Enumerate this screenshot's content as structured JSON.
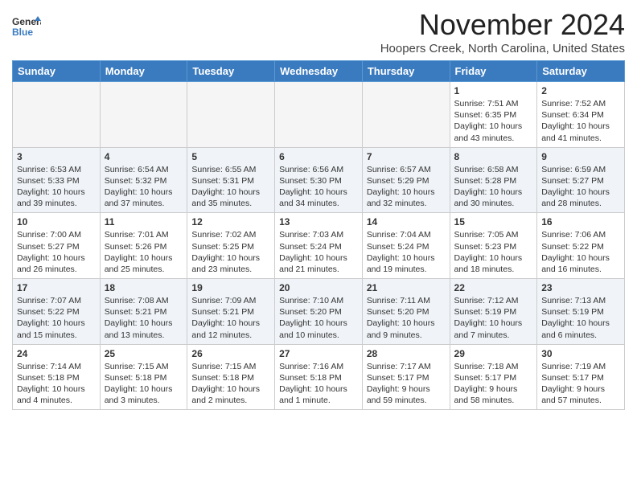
{
  "header": {
    "logo_line1": "General",
    "logo_line2": "Blue",
    "month": "November 2024",
    "location": "Hoopers Creek, North Carolina, United States"
  },
  "weekdays": [
    "Sunday",
    "Monday",
    "Tuesday",
    "Wednesday",
    "Thursday",
    "Friday",
    "Saturday"
  ],
  "weeks": [
    [
      {
        "day": "",
        "info": ""
      },
      {
        "day": "",
        "info": ""
      },
      {
        "day": "",
        "info": ""
      },
      {
        "day": "",
        "info": ""
      },
      {
        "day": "",
        "info": ""
      },
      {
        "day": "1",
        "info": "Sunrise: 7:51 AM\nSunset: 6:35 PM\nDaylight: 10 hours and 43 minutes."
      },
      {
        "day": "2",
        "info": "Sunrise: 7:52 AM\nSunset: 6:34 PM\nDaylight: 10 hours and 41 minutes."
      }
    ],
    [
      {
        "day": "3",
        "info": "Sunrise: 6:53 AM\nSunset: 5:33 PM\nDaylight: 10 hours and 39 minutes."
      },
      {
        "day": "4",
        "info": "Sunrise: 6:54 AM\nSunset: 5:32 PM\nDaylight: 10 hours and 37 minutes."
      },
      {
        "day": "5",
        "info": "Sunrise: 6:55 AM\nSunset: 5:31 PM\nDaylight: 10 hours and 35 minutes."
      },
      {
        "day": "6",
        "info": "Sunrise: 6:56 AM\nSunset: 5:30 PM\nDaylight: 10 hours and 34 minutes."
      },
      {
        "day": "7",
        "info": "Sunrise: 6:57 AM\nSunset: 5:29 PM\nDaylight: 10 hours and 32 minutes."
      },
      {
        "day": "8",
        "info": "Sunrise: 6:58 AM\nSunset: 5:28 PM\nDaylight: 10 hours and 30 minutes."
      },
      {
        "day": "9",
        "info": "Sunrise: 6:59 AM\nSunset: 5:27 PM\nDaylight: 10 hours and 28 minutes."
      }
    ],
    [
      {
        "day": "10",
        "info": "Sunrise: 7:00 AM\nSunset: 5:27 PM\nDaylight: 10 hours and 26 minutes."
      },
      {
        "day": "11",
        "info": "Sunrise: 7:01 AM\nSunset: 5:26 PM\nDaylight: 10 hours and 25 minutes."
      },
      {
        "day": "12",
        "info": "Sunrise: 7:02 AM\nSunset: 5:25 PM\nDaylight: 10 hours and 23 minutes."
      },
      {
        "day": "13",
        "info": "Sunrise: 7:03 AM\nSunset: 5:24 PM\nDaylight: 10 hours and 21 minutes."
      },
      {
        "day": "14",
        "info": "Sunrise: 7:04 AM\nSunset: 5:24 PM\nDaylight: 10 hours and 19 minutes."
      },
      {
        "day": "15",
        "info": "Sunrise: 7:05 AM\nSunset: 5:23 PM\nDaylight: 10 hours and 18 minutes."
      },
      {
        "day": "16",
        "info": "Sunrise: 7:06 AM\nSunset: 5:22 PM\nDaylight: 10 hours and 16 minutes."
      }
    ],
    [
      {
        "day": "17",
        "info": "Sunrise: 7:07 AM\nSunset: 5:22 PM\nDaylight: 10 hours and 15 minutes."
      },
      {
        "day": "18",
        "info": "Sunrise: 7:08 AM\nSunset: 5:21 PM\nDaylight: 10 hours and 13 minutes."
      },
      {
        "day": "19",
        "info": "Sunrise: 7:09 AM\nSunset: 5:21 PM\nDaylight: 10 hours and 12 minutes."
      },
      {
        "day": "20",
        "info": "Sunrise: 7:10 AM\nSunset: 5:20 PM\nDaylight: 10 hours and 10 minutes."
      },
      {
        "day": "21",
        "info": "Sunrise: 7:11 AM\nSunset: 5:20 PM\nDaylight: 10 hours and 9 minutes."
      },
      {
        "day": "22",
        "info": "Sunrise: 7:12 AM\nSunset: 5:19 PM\nDaylight: 10 hours and 7 minutes."
      },
      {
        "day": "23",
        "info": "Sunrise: 7:13 AM\nSunset: 5:19 PM\nDaylight: 10 hours and 6 minutes."
      }
    ],
    [
      {
        "day": "24",
        "info": "Sunrise: 7:14 AM\nSunset: 5:18 PM\nDaylight: 10 hours and 4 minutes."
      },
      {
        "day": "25",
        "info": "Sunrise: 7:15 AM\nSunset: 5:18 PM\nDaylight: 10 hours and 3 minutes."
      },
      {
        "day": "26",
        "info": "Sunrise: 7:15 AM\nSunset: 5:18 PM\nDaylight: 10 hours and 2 minutes."
      },
      {
        "day": "27",
        "info": "Sunrise: 7:16 AM\nSunset: 5:18 PM\nDaylight: 10 hours and 1 minute."
      },
      {
        "day": "28",
        "info": "Sunrise: 7:17 AM\nSunset: 5:17 PM\nDaylight: 9 hours and 59 minutes."
      },
      {
        "day": "29",
        "info": "Sunrise: 7:18 AM\nSunset: 5:17 PM\nDaylight: 9 hours and 58 minutes."
      },
      {
        "day": "30",
        "info": "Sunrise: 7:19 AM\nSunset: 5:17 PM\nDaylight: 9 hours and 57 minutes."
      }
    ]
  ]
}
